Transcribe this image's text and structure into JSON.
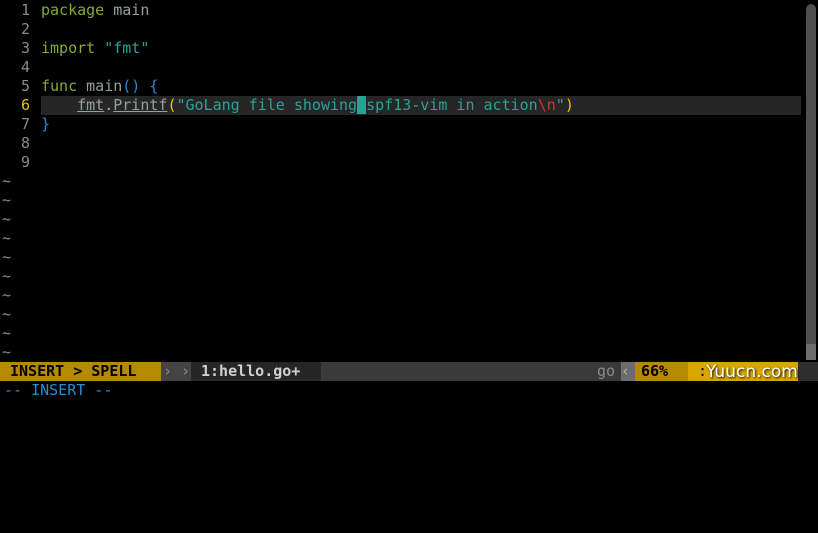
{
  "editor": {
    "lines": [
      {
        "num": "1",
        "parts": [
          {
            "t": "package",
            "c": "kw"
          },
          {
            "t": " main",
            "c": "id"
          }
        ]
      },
      {
        "num": "2",
        "parts": []
      },
      {
        "num": "3",
        "parts": [
          {
            "t": "import",
            "c": "kw"
          },
          {
            "t": " ",
            "c": "id"
          },
          {
            "t": "\"fmt\"",
            "c": "str"
          }
        ]
      },
      {
        "num": "4",
        "parts": []
      },
      {
        "num": "5",
        "parts": [
          {
            "t": "func",
            "c": "kw"
          },
          {
            "t": " main",
            "c": "id"
          },
          {
            "t": "()",
            "c": "paren"
          },
          {
            "t": " ",
            "c": "id"
          },
          {
            "t": "{",
            "c": "paren"
          }
        ]
      },
      {
        "num": "6",
        "current": true,
        "parts": [
          {
            "t": "    ",
            "c": "id"
          },
          {
            "t": "fmt",
            "c": "fn"
          },
          {
            "t": ".",
            "c": "id"
          },
          {
            "t": "Printf",
            "c": "fn"
          },
          {
            "t": "(",
            "c": "paren-match"
          },
          {
            "t": "\"GoLang file showing",
            "c": "str"
          },
          {
            "t": " ",
            "c": "cursor"
          },
          {
            "t": "spf13-vim in action",
            "c": "str"
          },
          {
            "t": "\\n",
            "c": "esc"
          },
          {
            "t": "\"",
            "c": "str"
          },
          {
            "t": ")",
            "c": "paren-match"
          }
        ]
      },
      {
        "num": "7",
        "parts": [
          {
            "t": "}",
            "c": "paren"
          }
        ]
      },
      {
        "num": "8",
        "parts": []
      },
      {
        "num": "9",
        "parts": []
      }
    ],
    "tilde": "~",
    "tilde_count": 10
  },
  "statusbar": {
    "mode": "INSERT > SPELL",
    "sep1": "› ›",
    "file": "1:hello.go+",
    "filetype": "go",
    "sep2": "‹",
    "percent": "66%",
    "position": ":"
  },
  "watermark": "Yuucn.com",
  "cmdline": "-- INSERT --"
}
